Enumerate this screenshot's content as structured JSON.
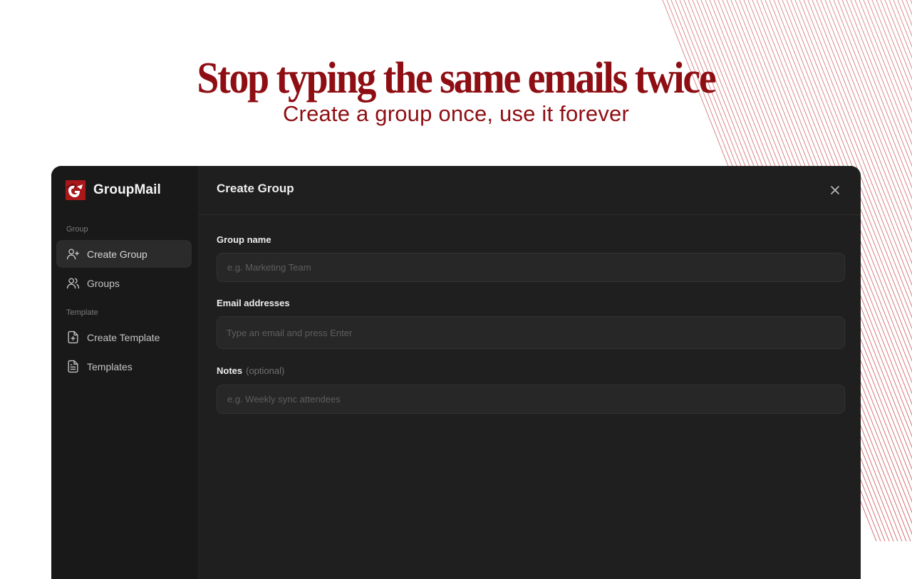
{
  "hero": {
    "title": "Stop typing the same emails twice",
    "subtitle": "Create a group once, use it forever"
  },
  "colors": {
    "brand": "#a8181b",
    "headline": "#8e0e13",
    "sidebar_bg": "#191919",
    "panel_bg": "#1f1f1f"
  },
  "app": {
    "brand_name": "GroupMail",
    "sidebar": {
      "sections": [
        {
          "label": "Group",
          "items": [
            {
              "label": "Create Group",
              "icon": "user-plus-icon",
              "active": true
            },
            {
              "label": "Groups",
              "icon": "users-icon",
              "active": false
            }
          ]
        },
        {
          "label": "Template",
          "items": [
            {
              "label": "Create Template",
              "icon": "file-plus-icon",
              "active": false
            },
            {
              "label": "Templates",
              "icon": "file-text-icon",
              "active": false
            }
          ]
        }
      ]
    },
    "main": {
      "title": "Create Group",
      "close_icon": "close-icon",
      "fields": {
        "group_name": {
          "label": "Group name",
          "placeholder": "e.g. Marketing Team",
          "value": ""
        },
        "emails": {
          "label": "Email addresses",
          "placeholder": "Type an email and press Enter",
          "value": ""
        },
        "notes": {
          "label": "Notes",
          "optional": "(optional)",
          "placeholder": "e.g. Weekly sync attendees",
          "value": ""
        }
      }
    }
  }
}
